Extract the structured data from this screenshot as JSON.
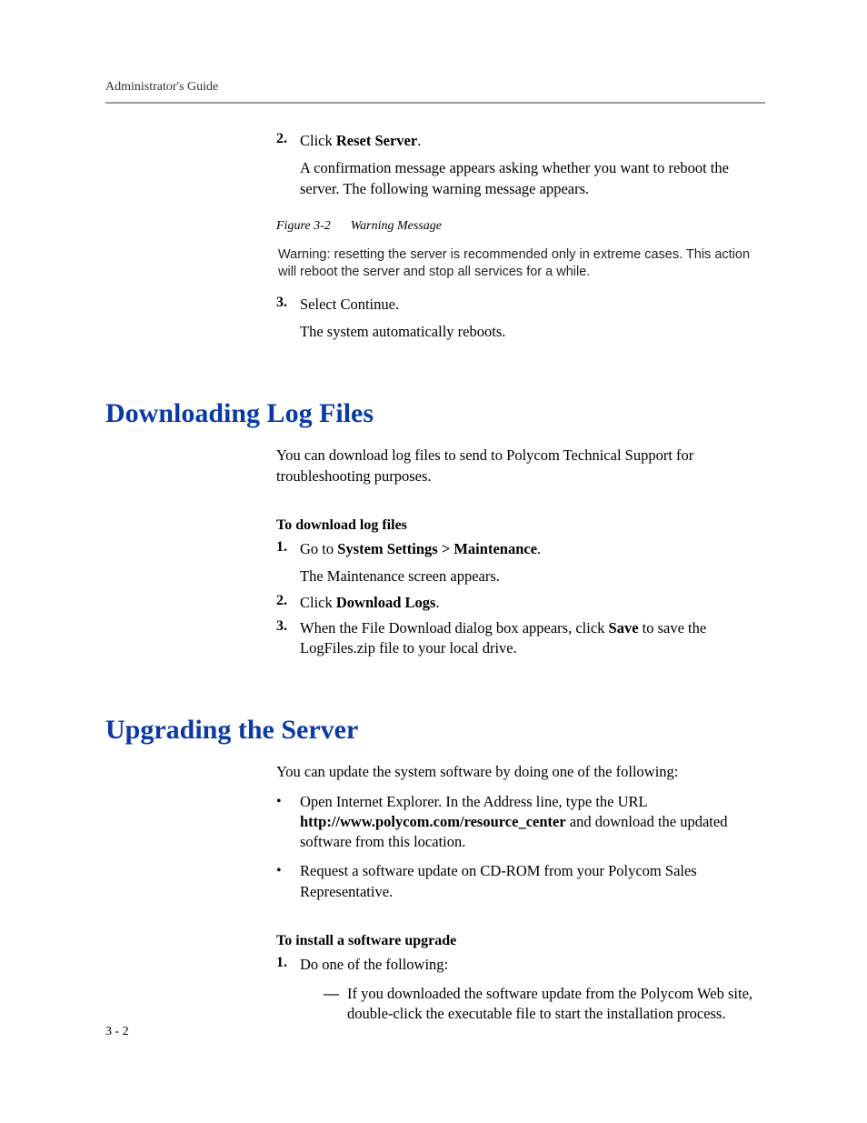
{
  "header": {
    "title": "Administrator's Guide"
  },
  "steps_top": {
    "s2": {
      "num": "2.",
      "line1_a": "Click ",
      "line1_b": "Reset Server",
      "line1_c": ".",
      "follow": "A confirmation message appears asking whether you want to reboot the server. The following warning message appears."
    },
    "figcap_a": "Figure 3-2",
    "figcap_b": "Warning Message",
    "warning": "Warning: resetting the server is recommended only in extreme cases. This action will reboot the server and stop all services for a while.",
    "s3": {
      "num": "3.",
      "line1": "Select Continue.",
      "follow": "The system automatically reboots."
    }
  },
  "section1": {
    "title": "Downloading Log Files",
    "intro": "You can download log files to send to Polycom Technical Support for troubleshooting purposes.",
    "subhead": "To download log files",
    "s1": {
      "num": "1.",
      "a": "Go to ",
      "b": "System Settings > Maintenance",
      "c": ".",
      "follow": "The Maintenance screen appears."
    },
    "s2": {
      "num": "2.",
      "a": "Click ",
      "b": "Download Logs",
      "c": "."
    },
    "s3": {
      "num": "3.",
      "a": "When the File Download dialog box appears, click ",
      "b": "Save",
      "c": " to save the LogFiles.zip file to your local drive."
    }
  },
  "section2": {
    "title": "Upgrading the Server",
    "intro": "You can update the system software by doing one of the following:",
    "b1": {
      "a": "Open Internet Explorer. In the Address line, type the URL ",
      "b": "http://www.polycom.com/resource_center",
      "c": " and download the updated software from this location."
    },
    "b2": "Request a software update on CD-ROM from your Polycom Sales Representative.",
    "subhead": "To install a software upgrade",
    "s1": {
      "num": "1.",
      "text": "Do one of the following:",
      "d1": "If you downloaded the software update from the Polycom Web site, double-click the executable file to start the installation process."
    }
  },
  "pagenum": "3 - 2"
}
